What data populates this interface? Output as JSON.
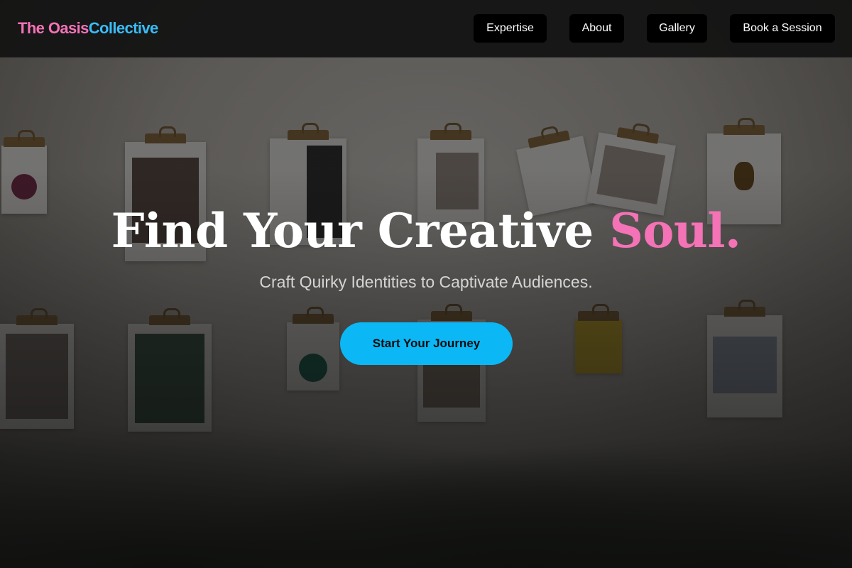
{
  "header": {
    "logo": {
      "part1": "The Oasis",
      "part2": "Collective"
    },
    "nav": {
      "expertise": "Expertise",
      "about": "About",
      "gallery": "Gallery",
      "book": "Book a Session"
    }
  },
  "hero": {
    "headline_main": "Find Your Creative ",
    "headline_accent": "Soul.",
    "subtitle": "Craft Quirky Identities to Captivate Audiences.",
    "cta_label": "Start Your Journey",
    "background": "clipboards-wall-photo"
  },
  "colors": {
    "brand_pink": "#f472b6",
    "brand_blue": "#38bdf8",
    "cta_blue": "#0bb8f5",
    "nav_button_bg": "#000000",
    "header_bg": "#121212"
  }
}
